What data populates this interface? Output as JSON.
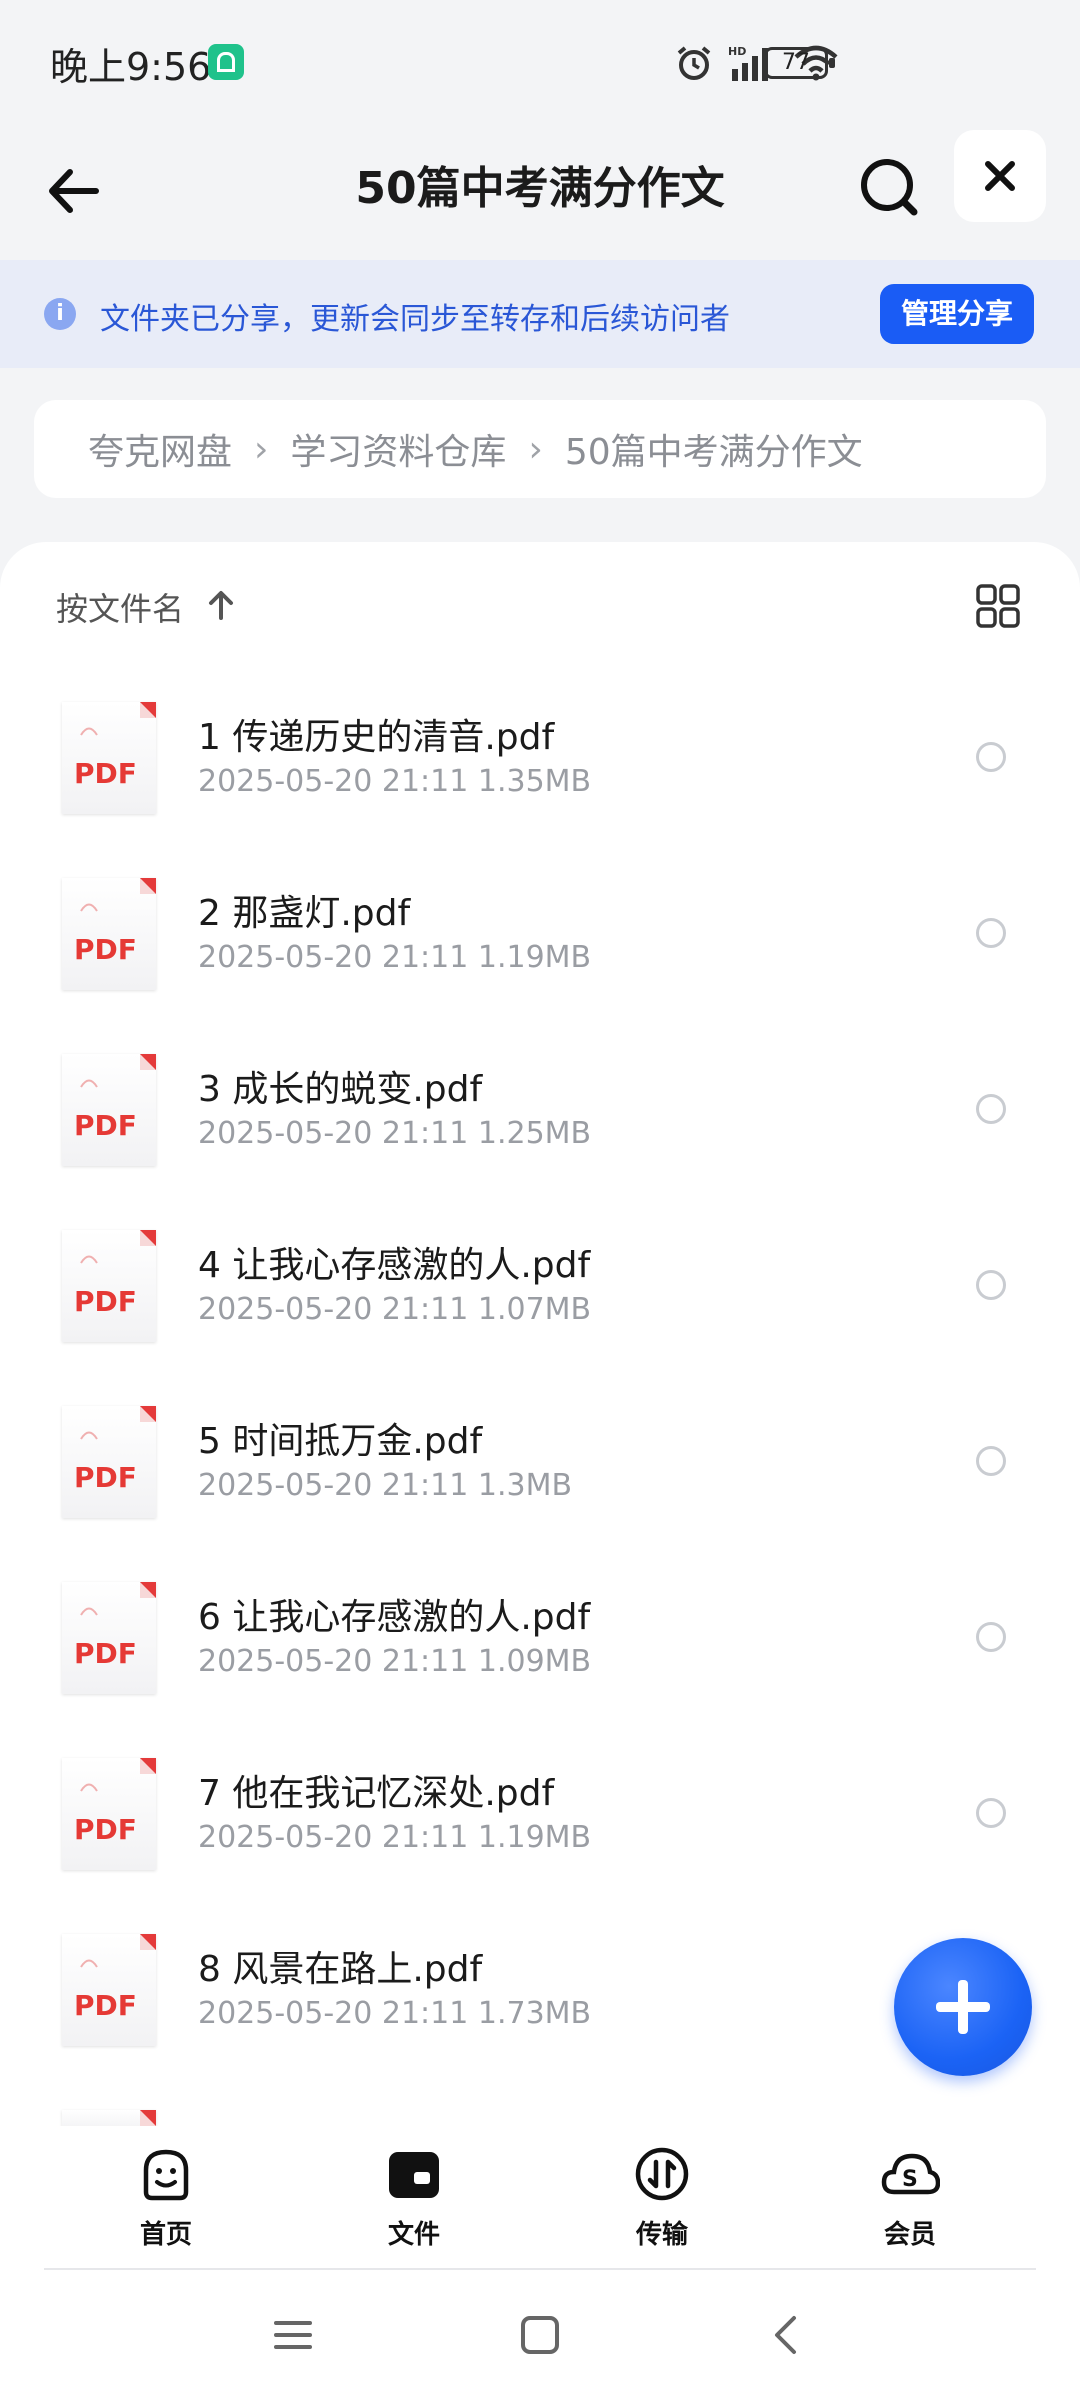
{
  "status_bar": {
    "time": "晚上9:56",
    "battery": "77"
  },
  "header": {
    "title": "50篇中考满分作文"
  },
  "share_banner": {
    "text": "文件夹已分享，更新会同步至转存和后续访问者",
    "button": "管理分享"
  },
  "breadcrumb": [
    "夸克网盘",
    "学习资料仓库",
    "50篇中考满分作文"
  ],
  "list": {
    "sort_label": "按文件名",
    "files": [
      {
        "name": "1 传递历史的清音.pdf",
        "meta": "2025-05-20 21:11  1.35MB"
      },
      {
        "name": "2 那盏灯.pdf",
        "meta": "2025-05-20 21:11  1.19MB"
      },
      {
        "name": "3 成长的蜕变.pdf",
        "meta": "2025-05-20 21:11  1.25MB"
      },
      {
        "name": "4 让我心存感激的人.pdf",
        "meta": "2025-05-20 21:11  1.07MB"
      },
      {
        "name": "5 时间抵万金.pdf",
        "meta": "2025-05-20 21:11  1.3MB"
      },
      {
        "name": "6 让我心存感激的人.pdf",
        "meta": "2025-05-20 21:11  1.09MB"
      },
      {
        "name": "7 他在我记忆深处.pdf",
        "meta": "2025-05-20 21:11  1.19MB"
      },
      {
        "name": "8 风景在路上.pdf",
        "meta": "2025-05-20 21:11  1.73MB"
      }
    ],
    "pdf_badge": "PDF"
  },
  "bottom_tabs": [
    {
      "label": "首页",
      "icon": "smile-face-icon"
    },
    {
      "label": "文件",
      "icon": "folder-icon"
    },
    {
      "label": "传输",
      "icon": "transfer-icon"
    },
    {
      "label": "会员",
      "icon": "cloud-member-icon"
    }
  ],
  "colors": {
    "accent": "#1a5cf5",
    "banner_bg": "#e8ecf8",
    "pdf_red": "#e53935"
  }
}
